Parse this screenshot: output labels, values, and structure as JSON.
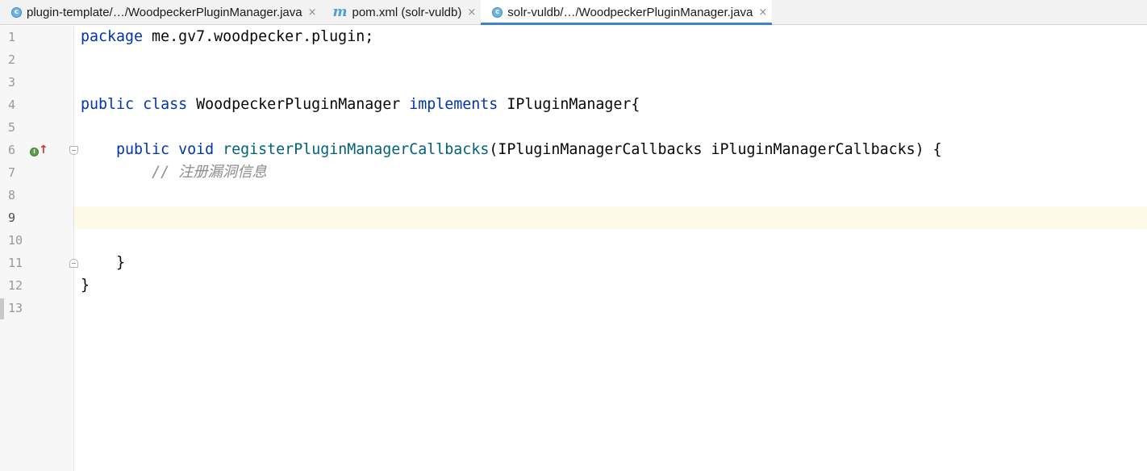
{
  "tabs": [
    {
      "icon": "class-icon",
      "label": "plugin-template/…/WoodpeckerPluginManager.java",
      "close": "×",
      "active": false
    },
    {
      "icon": "maven-icon",
      "label": "pom.xml (solr-vuldb)",
      "close": "×",
      "active": false
    },
    {
      "icon": "class-icon",
      "label": "solr-vuldb/…/WoodpeckerPluginManager.java",
      "close": "×",
      "active": true
    }
  ],
  "icons": {
    "class_glyph": "c",
    "maven_glyph": "m",
    "impl_glyph": "I",
    "impl_arrow": "↑"
  },
  "editor": {
    "current_line": 9,
    "line_numbers": [
      "1",
      "2",
      "3",
      "4",
      "5",
      "6",
      "7",
      "8",
      "9",
      "10",
      "11",
      "12",
      "13"
    ],
    "code": {
      "l1_kw": "package",
      "l1_rest": " me.gv7.woodpecker.plugin;",
      "l4_kw1": "public",
      "l4_sp1": " ",
      "l4_kw2": "class",
      "l4_name": " WoodpeckerPluginManager ",
      "l4_kw3": "implements",
      "l4_rest": " IPluginManager{",
      "l6_indent": "    ",
      "l6_kw1": "public",
      "l6_sp1": " ",
      "l6_kw2": "void",
      "l6_sp2": " ",
      "l6_fn": "registerPluginManagerCallbacks",
      "l6_rest": "(IPluginManagerCallbacks iPluginManagerCallbacks) {",
      "l7_indent": "        ",
      "l7_comment": "// 注册漏洞信息",
      "l11_text": "    }",
      "l12_text": "}"
    }
  },
  "colors": {
    "keyword": "#0033b3",
    "method": "#00627a",
    "comment": "#8c8c8c",
    "current_line_bg": "#fdfae8",
    "tab_underline": "#4083c9"
  }
}
